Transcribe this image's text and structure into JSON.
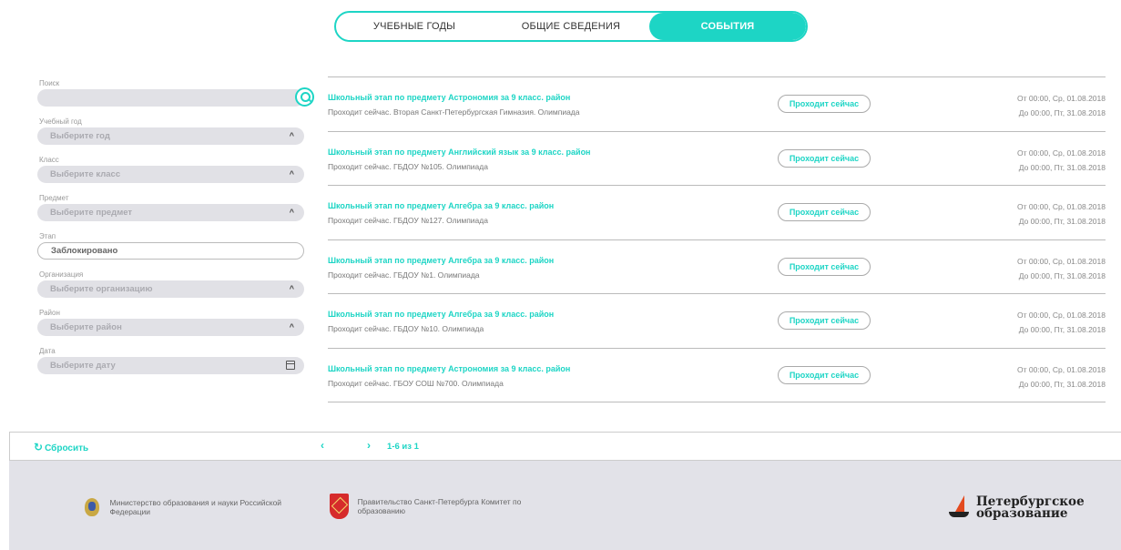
{
  "tabs": [
    {
      "label": "УЧЕБНЫЕ ГОДЫ",
      "active": false
    },
    {
      "label": "ОБЩИЕ СВЕДЕНИЯ",
      "active": false
    },
    {
      "label": "СОБЫТИЯ",
      "active": true
    }
  ],
  "filters": {
    "search": {
      "label": "Поиск",
      "value": "",
      "icon": "search-icon"
    },
    "year": {
      "label": "Учебный год",
      "placeholder": "Выберите год"
    },
    "class": {
      "label": "Класс",
      "placeholder": "Выберите класс"
    },
    "subject": {
      "label": "Предмет",
      "placeholder": "Выберите предмет"
    },
    "stage": {
      "label": "Этап",
      "value": "Заблокировано"
    },
    "organization": {
      "label": "Организация",
      "placeholder": "Выберите организацию"
    },
    "district": {
      "label": "Район",
      "placeholder": "Выберите район"
    },
    "date": {
      "label": "Дата",
      "placeholder": "Выберите дату",
      "icon": "calendar-icon"
    }
  },
  "events": [
    {
      "title": "Школьный этап по предмету Астрономия за 9 класс. район",
      "subtitle": "Проходит сейчас. Вторая Санкт-Петербургская Гимназия. Олимпиада",
      "status": "Проходит сейчас",
      "from": "От 00:00, Ср, 01.08.2018",
      "to": "До 00:00, Пт, 31.08.2018"
    },
    {
      "title": "Школьный этап по предмету Английский язык за 9 класс. район",
      "subtitle": "Проходит сейчас. ГБДОУ №105. Олимпиада",
      "status": "Проходит сейчас",
      "from": "От 00:00, Ср, 01.08.2018",
      "to": "До 00:00, Пт, 31.08.2018"
    },
    {
      "title": "Школьный этап по предмету Алгебра за 9 класс. район",
      "subtitle": "Проходит сейчас. ГБДОУ №127. Олимпиада",
      "status": "Проходит сейчас",
      "from": "От 00:00, Ср, 01.08.2018",
      "to": "До 00:00, Пт, 31.08.2018"
    },
    {
      "title": "Школьный этап по предмету Алгебра за 9 класс. район",
      "subtitle": "Проходит сейчас. ГБДОУ №1. Олимпиада",
      "status": "Проходит сейчас",
      "from": "От 00:00, Ср, 01.08.2018",
      "to": "До 00:00, Пт, 31.08.2018"
    },
    {
      "title": "Школьный этап по предмету Алгебра за 9 класс. район",
      "subtitle": "Проходит сейчас. ГБДОУ №10. Олимпиада",
      "status": "Проходит сейчас",
      "from": "От 00:00, Ср, 01.08.2018",
      "to": "До 00:00, Пт, 31.08.2018"
    },
    {
      "title": "Школьный этап по предмету Астрономия за 9 класс. район",
      "subtitle": "Проходит сейчас. ГБОУ СОШ №700. Олимпиада",
      "status": "Проходит сейчас",
      "from": "От 00:00, Ср, 01.08.2018",
      "to": "До 00:00, Пт, 31.08.2018"
    }
  ],
  "bottombar": {
    "reset_label": "Сбросить",
    "reset_icon": "refresh-icon",
    "prev": "‹",
    "next": "›",
    "page_info": "1-6 из 1"
  },
  "footer": {
    "ministry": "Министерство образования и науки Российской Федерации",
    "government": "Правительство Санкт-Петербурга Комитет по образованию",
    "logo_line1": "Петербургское",
    "logo_line2": "образование"
  },
  "colors": {
    "accent": "#1dd5c5",
    "field_bg": "#e1e1e6",
    "footer_bg": "#e2e2e8"
  }
}
